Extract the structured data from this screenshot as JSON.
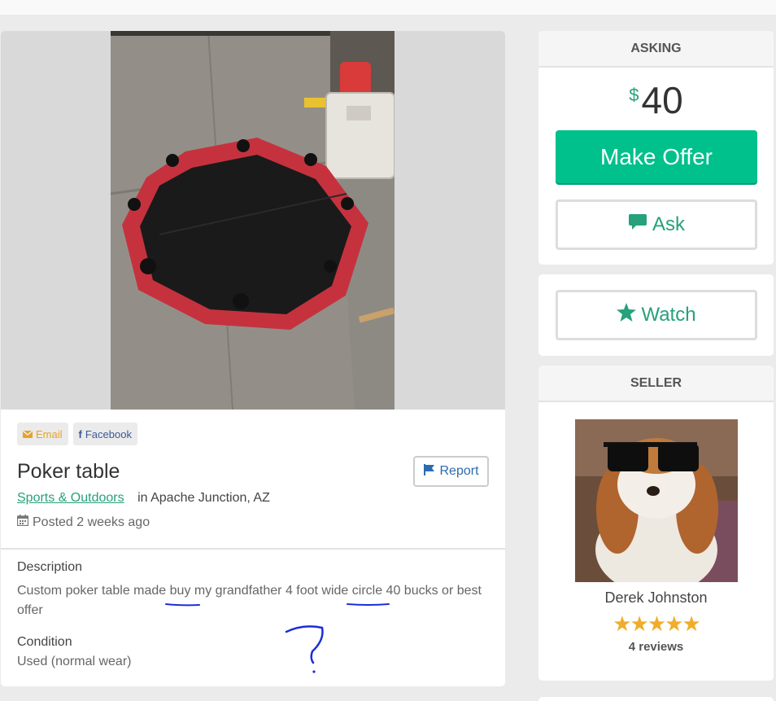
{
  "colors": {
    "accent": "#00c08b",
    "link": "#26a17b",
    "star": "#f0ad2a",
    "report": "#2b6cb0",
    "ink": "#1a2fd6"
  },
  "share": {
    "email_label": "Email",
    "facebook_label": "Facebook",
    "email_icon": "envelope-icon",
    "facebook_icon": "facebook-icon"
  },
  "listing": {
    "title": "Poker table",
    "report_label": "Report",
    "category": "Sports & Outdoors",
    "location": "in Apache Junction, AZ",
    "posted": "Posted 2 weeks ago",
    "description_heading": "Description",
    "description": "Custom poker table made buy my grandfather 4 foot wide circle 40 bucks or best offer",
    "condition_heading": "Condition",
    "condition": "Used (normal wear)"
  },
  "asking": {
    "heading": "ASKING",
    "currency": "$",
    "price": "40",
    "make_offer_label": "Make Offer",
    "ask_label": "Ask",
    "watch_label": "Watch"
  },
  "seller": {
    "heading": "SELLER",
    "name": "Derek Johnston",
    "rating": 5,
    "reviews": "4 reviews"
  }
}
